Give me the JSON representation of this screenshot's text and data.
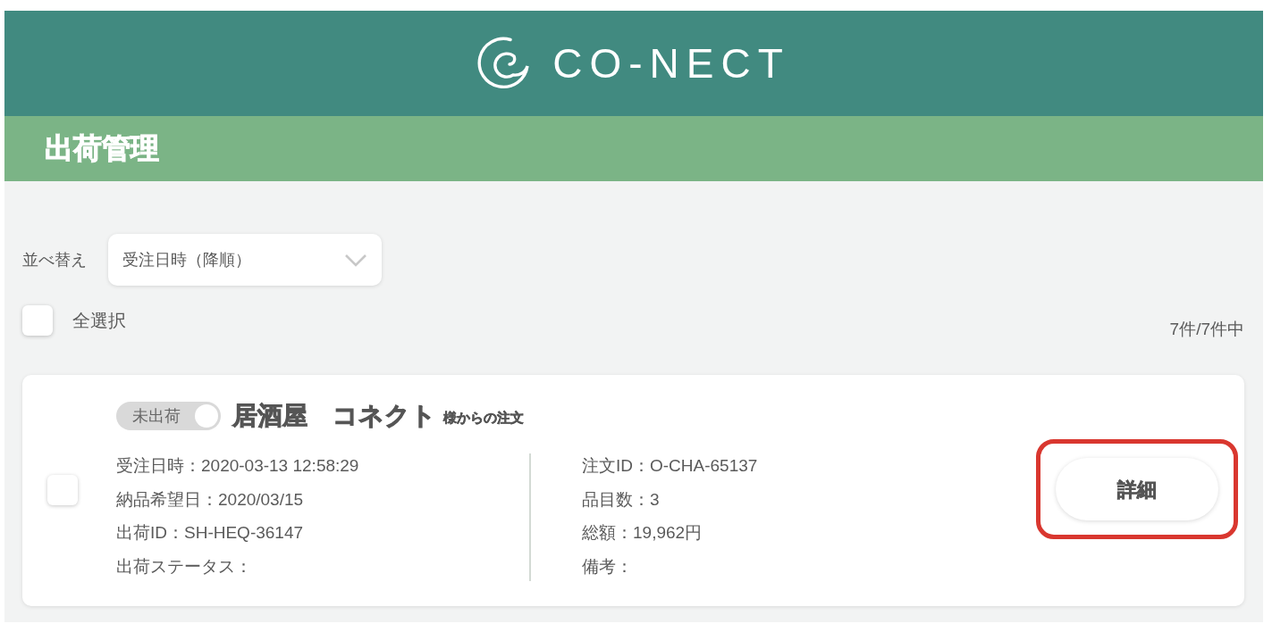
{
  "header": {
    "logo_text": "CO-NECT"
  },
  "page_title": "出荷管理",
  "sort": {
    "label": "並べ替え",
    "value": "受注日時（降順）"
  },
  "select_all": {
    "label": "全選択",
    "checked": false
  },
  "count": "7件/7件中",
  "orders": [
    {
      "checked": false,
      "status": {
        "label": "未出荷",
        "on": false
      },
      "customer": "居酒屋　コネクト",
      "customer_suffix": "様からの注文",
      "details_left": [
        "受注日時：2020-03-13 12:58:29",
        "納品希望日：2020/03/15",
        "出荷ID：SH-HEQ-36147",
        "出荷ステータス："
      ],
      "details_right": [
        "注文ID：O-CHA-65137",
        "品目数：3",
        "総額：19,962円",
        "備考："
      ],
      "detail_button": {
        "label": "詳細",
        "highlighted": true
      }
    }
  ]
}
